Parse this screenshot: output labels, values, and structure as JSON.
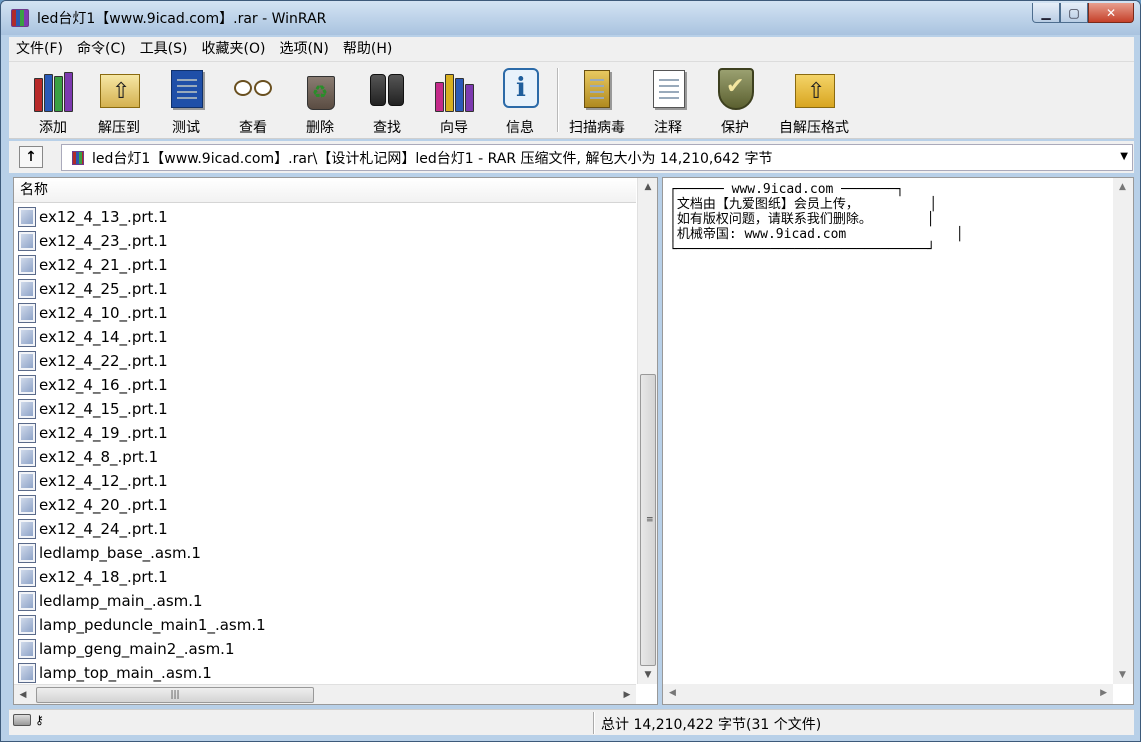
{
  "window": {
    "title": "led台灯1【www.9icad.com】.rar - WinRAR"
  },
  "menu": [
    "文件(F)",
    "命令(C)",
    "工具(S)",
    "收藏夹(O)",
    "选项(N)",
    "帮助(H)"
  ],
  "toolbar": {
    "add": "添加",
    "extract_to": "解压到",
    "test": "测试",
    "view": "查看",
    "delete": "删除",
    "find": "查找",
    "wizard": "向导",
    "info": "信息",
    "virus_scan": "扫描病毒",
    "comment": "注释",
    "protect": "保护",
    "sfx": "自解压格式"
  },
  "address": {
    "path": "led台灯1【www.9icad.com】.rar\\【设计札记网】led台灯1 - RAR 压缩文件, 解包大小为 14,210,642 字节"
  },
  "file_list": {
    "column_name": "名称",
    "files": [
      "ex12_4_13_.prt.1",
      "ex12_4_23_.prt.1",
      "ex12_4_21_.prt.1",
      "ex12_4_25_.prt.1",
      "ex12_4_10_.prt.1",
      "ex12_4_14_.prt.1",
      "ex12_4_22_.prt.1",
      "ex12_4_16_.prt.1",
      "ex12_4_15_.prt.1",
      "ex12_4_19_.prt.1",
      "ex12_4_8_.prt.1",
      "ex12_4_12_.prt.1",
      "ex12_4_20_.prt.1",
      "ex12_4_24_.prt.1",
      "ledlamp_base_.asm.1",
      "ex12_4_18_.prt.1",
      "ledlamp_main_.asm.1",
      "lamp_peduncle_main1_.asm.1",
      "lamp_geng_main2_.asm.1",
      "lamp_top_main_.asm.1"
    ]
  },
  "comment_panel": {
    "lines": [
      "┌────── www.9icad.com ───────┐",
      "│文档由【九爱图纸】会员上传，         │",
      "│如有版权问题，请联系我们删除。       │",
      "│机械帝国: www.9icad.com              │",
      "└────────────────────────────────┘"
    ]
  },
  "status": {
    "total": "总计 14,210,422 字节(31 个文件)"
  }
}
